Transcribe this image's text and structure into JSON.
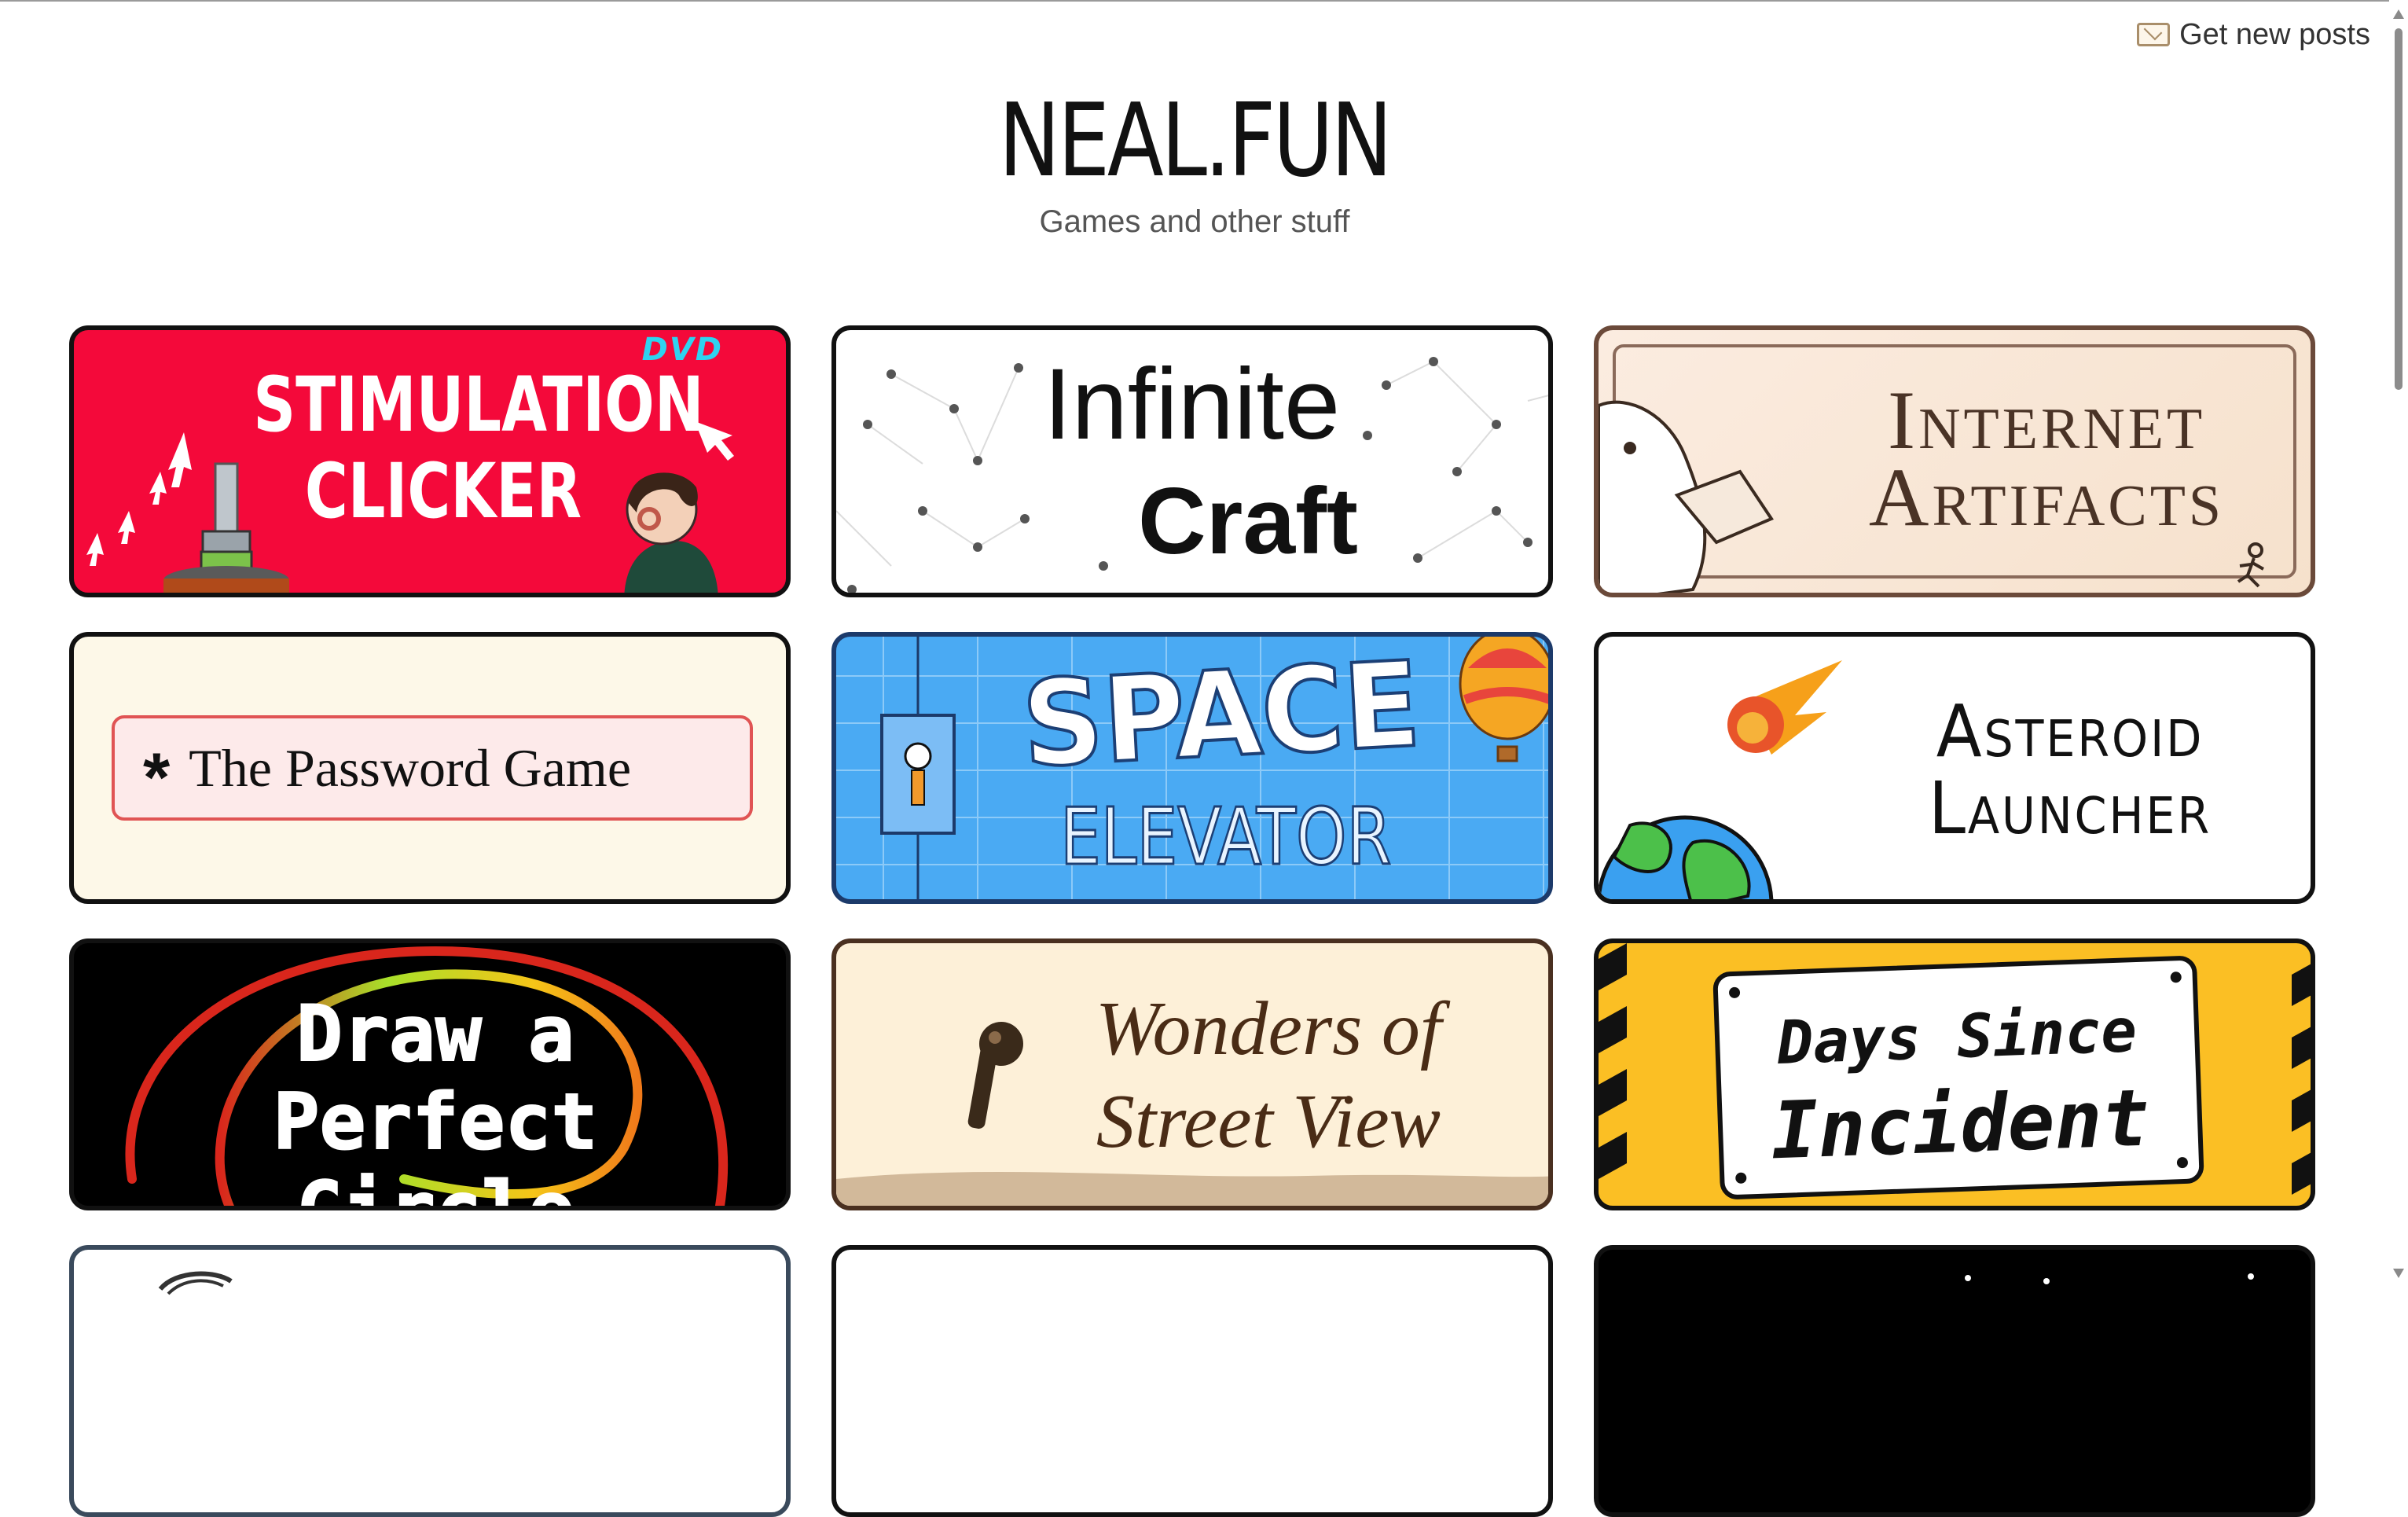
{
  "header": {
    "newsletter_label": "Get new posts",
    "site_title": "NEAL.FUN",
    "tagline": "Games and other stuff"
  },
  "cards": [
    {
      "id": "stimulation-clicker",
      "lines": [
        "STIMULATION",
        "CLICKER"
      ],
      "badge": "DVD",
      "bg": "#f4093a"
    },
    {
      "id": "infinite-craft",
      "lines": [
        "Infinite",
        "Craft"
      ],
      "bg": "#ffffff"
    },
    {
      "id": "internet-artifacts",
      "lines": [
        "Internet",
        "Artifacts"
      ],
      "bg": "#fbece0"
    },
    {
      "id": "password-game",
      "symbol": "*",
      "title": "The Password Game",
      "bg": "#fdf8e8"
    },
    {
      "id": "space-elevator",
      "lines": [
        "SPACE",
        "ELEVATOR"
      ],
      "bg": "#4aaaf3"
    },
    {
      "id": "asteroid-launcher",
      "lines": [
        "Asteroid",
        "Launcher"
      ],
      "bg": "#ffffff"
    },
    {
      "id": "draw-perfect-circle",
      "lines": [
        "Draw a",
        "Perfect Circle"
      ],
      "bg": "#000000"
    },
    {
      "id": "wonders-street-view",
      "lines": [
        "Wonders of",
        "Street View"
      ],
      "bg": "#fdf0d8"
    },
    {
      "id": "days-since-incident",
      "lines": [
        "Days Since",
        "Incident"
      ],
      "bg": "#fbbf24"
    }
  ],
  "icons": {
    "newsletter": "envelope-icon",
    "stimulation": [
      "cursor-icon",
      "hydraulic-press-icon",
      "girl-with-headphones-icon"
    ],
    "infinite_craft": "constellation-lines-icon",
    "internet_artifacts": [
      "seal-holding-computer-icon",
      "running-person-icon"
    ],
    "space_elevator": [
      "elevator-cabin-icon",
      "hot-air-balloon-icon"
    ],
    "asteroid_launcher": [
      "asteroid-fireball-icon",
      "earth-icon"
    ],
    "street_view": "street-view-pegman-icon"
  }
}
